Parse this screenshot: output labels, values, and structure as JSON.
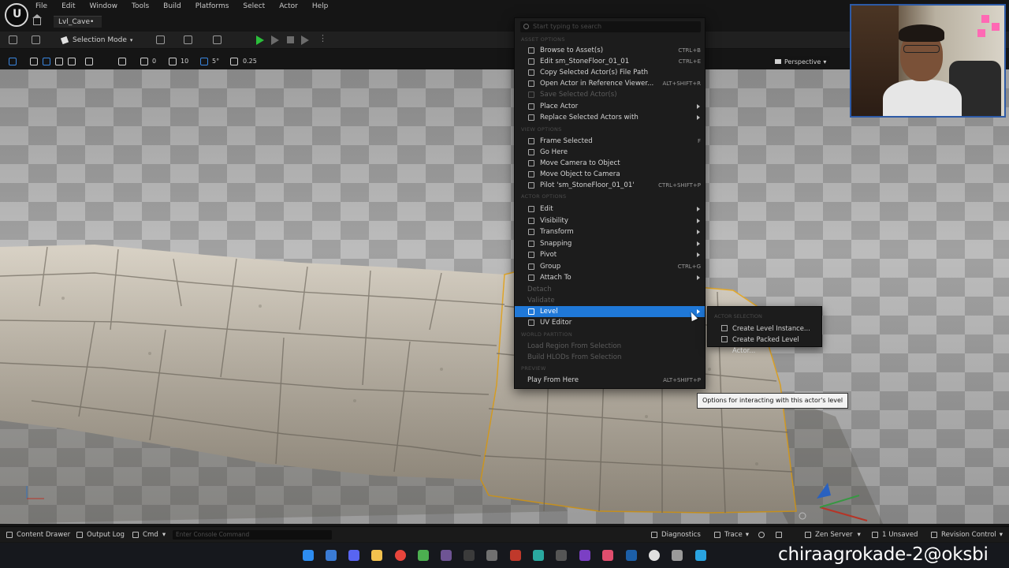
{
  "menubar": {
    "items": [
      "File",
      "Edit",
      "Window",
      "Tools",
      "Build",
      "Platforms",
      "Select",
      "Actor",
      "Help"
    ],
    "level_tab": "Lvl_Cave•"
  },
  "toolbar": {
    "mode_label": "Selection Mode",
    "play_color": "#2bbf3b"
  },
  "viewport_toolbar": {
    "rotation_snap": "0",
    "grid_snap": "10",
    "angle_snap": "5°",
    "scale_snap": "0.25",
    "view_mode": "Perspective"
  },
  "context_menu": {
    "search_placeholder": "Start typing to search",
    "sections": {
      "asset": "ASSET OPTIONS",
      "view": "VIEW OPTIONS",
      "actor": "ACTOR OPTIONS",
      "world_partition": "WORLD PARTITION",
      "preview": "PREVIEW"
    },
    "items": {
      "browse": {
        "label": "Browse to Asset(s)",
        "shortcut": "CTRL+B"
      },
      "edit_asset": {
        "label": "Edit sm_StoneFloor_01_01",
        "shortcut": "CTRL+E"
      },
      "copy_path": {
        "label": "Copy Selected Actor(s) File Path"
      },
      "open_ref": {
        "label": "Open Actor in Reference Viewer...",
        "shortcut": "ALT+SHIFT+R"
      },
      "save_actor": {
        "label": "Save Selected Actor(s)"
      },
      "place_actor": {
        "label": "Place Actor"
      },
      "replace_actors": {
        "label": "Replace Selected Actors with"
      },
      "frame_selected": {
        "label": "Frame Selected",
        "shortcut": "F"
      },
      "go_here": {
        "label": "Go Here"
      },
      "move_camera": {
        "label": "Move Camera to Object"
      },
      "move_object": {
        "label": "Move Object to Camera"
      },
      "pilot": {
        "label": "Pilot 'sm_StoneFloor_01_01'",
        "shortcut": "CTRL+SHIFT+P"
      },
      "edit": {
        "label": "Edit"
      },
      "visibility": {
        "label": "Visibility"
      },
      "transform": {
        "label": "Transform"
      },
      "snapping": {
        "label": "Snapping"
      },
      "pivot": {
        "label": "Pivot"
      },
      "group": {
        "label": "Group",
        "shortcut": "CTRL+G"
      },
      "attach": {
        "label": "Attach To"
      },
      "detach": {
        "label": "Detach"
      },
      "validate": {
        "label": "Validate"
      },
      "level": {
        "label": "Level"
      },
      "uv_editor": {
        "label": "UV Editor"
      },
      "load_region": {
        "label": "Load Region From Selection"
      },
      "build_hlods": {
        "label": "Build HLODs From Selection"
      },
      "play_from_here": {
        "label": "Play From Here",
        "shortcut": "ALT+SHIFT+P"
      }
    }
  },
  "submenu": {
    "section": "ACTOR SELECTION",
    "items": [
      "Create Level Instance...",
      "Create Packed Level Actor..."
    ]
  },
  "tooltip": "Options for interacting with this actor's level",
  "statusbar": {
    "content_drawer": "Content Drawer",
    "output_log": "Output Log",
    "cmd": "Cmd",
    "console_placeholder": "Enter Console Command",
    "diagnostics": "Diagnostics",
    "trace": "Trace",
    "zen_server": "Zen Server",
    "unsaved": "1 Unsaved",
    "revision_control": "Revision Control"
  },
  "watermark": "chiraagrokade-2@oksbi",
  "colors": {
    "accent": "#1f78d8",
    "selection_outline": "#e8a820"
  }
}
